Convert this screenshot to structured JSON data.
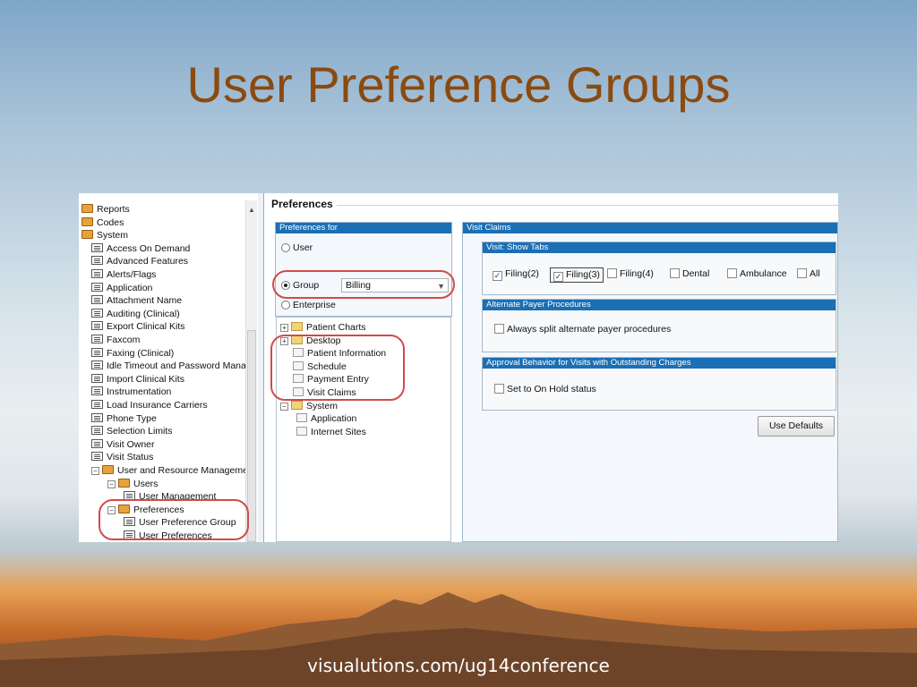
{
  "slide": {
    "title": "User Preference Groups",
    "footer": "visualutions.com/ug14conference"
  },
  "nav_tree": {
    "items": [
      {
        "label": "Reports",
        "icon": "folder-icon",
        "level": 0
      },
      {
        "label": "Codes",
        "icon": "folder-icon",
        "level": 0
      },
      {
        "label": "System",
        "icon": "folder-icon",
        "level": 0
      },
      {
        "label": "Access On Demand",
        "icon": "document-icon",
        "level": 1
      },
      {
        "label": "Advanced Features",
        "icon": "document-icon",
        "level": 1
      },
      {
        "label": "Alerts/Flags",
        "icon": "document-icon",
        "level": 1
      },
      {
        "label": "Application",
        "icon": "document-icon",
        "level": 1
      },
      {
        "label": "Attachment Name",
        "icon": "document-icon",
        "level": 1
      },
      {
        "label": "Auditing (Clinical)",
        "icon": "document-icon",
        "level": 1
      },
      {
        "label": "Export Clinical Kits",
        "icon": "document-icon",
        "level": 1
      },
      {
        "label": "Faxcom",
        "icon": "document-icon",
        "level": 1
      },
      {
        "label": "Faxing (Clinical)",
        "icon": "document-icon",
        "level": 1
      },
      {
        "label": "Idle Timeout and Password Manag",
        "icon": "document-icon",
        "level": 1
      },
      {
        "label": "Import Clinical Kits",
        "icon": "document-icon",
        "level": 1
      },
      {
        "label": "Instrumentation",
        "icon": "document-icon",
        "level": 1
      },
      {
        "label": "Load Insurance Carriers",
        "icon": "document-icon",
        "level": 1
      },
      {
        "label": "Phone Type",
        "icon": "document-icon",
        "level": 1
      },
      {
        "label": "Selection Limits",
        "icon": "document-icon",
        "level": 1
      },
      {
        "label": "Visit Owner",
        "icon": "document-icon",
        "level": 1
      },
      {
        "label": "Visit Status",
        "icon": "document-icon",
        "level": 1
      },
      {
        "label": "User and Resource Management",
        "icon": "folder-icon",
        "level": 1
      },
      {
        "label": "Users",
        "icon": "folder-icon",
        "level": 2
      },
      {
        "label": "User Management",
        "icon": "document-icon",
        "level": 3
      },
      {
        "label": "Preferences",
        "icon": "folder-icon",
        "level": 2
      },
      {
        "label": "User Preference Group",
        "icon": "document-icon",
        "level": 3
      },
      {
        "label": "User Preferences",
        "icon": "document-icon",
        "level": 3
      }
    ]
  },
  "preferences": {
    "title": "Preferences",
    "for_panel": {
      "header": "Preferences for",
      "user_label": "User",
      "group_label": "Group",
      "group_value": "Billing",
      "enterprise_label": "Enterprise",
      "selected": "Group"
    },
    "pref_tree": {
      "items": [
        {
          "label": "Patient Charts",
          "type": "folder",
          "toggle": "+"
        },
        {
          "label": "Desktop",
          "type": "folder",
          "toggle": "+"
        },
        {
          "label": "Patient Information",
          "type": "node"
        },
        {
          "label": "Schedule",
          "type": "node"
        },
        {
          "label": "Payment Entry",
          "type": "node"
        },
        {
          "label": "Visit Claims",
          "type": "node"
        },
        {
          "label": "System",
          "type": "folder",
          "toggle": "-"
        },
        {
          "label": "Application",
          "type": "node"
        },
        {
          "label": "Internet Sites",
          "type": "node"
        }
      ]
    },
    "visit_claims": {
      "header": "Visit Claims",
      "show_tabs": {
        "header": "Visit: Show Tabs",
        "options": [
          {
            "label": "Filing(2)",
            "checked": true
          },
          {
            "label": "Filing(3)",
            "checked": true
          },
          {
            "label": "Filing(4)",
            "checked": false
          },
          {
            "label": "Dental",
            "checked": false
          },
          {
            "label": "Ambulance",
            "checked": false
          },
          {
            "label": "All",
            "checked": false
          }
        ]
      },
      "alternate_payer": {
        "header": "Alternate Payer Procedures",
        "option": "Always split alternate payer procedures"
      },
      "approval": {
        "header": "Approval Behavior for Visits with Outstanding Charges",
        "option": "Set to On Hold status"
      },
      "use_defaults_label": "Use Defaults"
    }
  },
  "colors": {
    "title": "#8a4a10",
    "panel_header": "#1a6fb5",
    "highlight_oval": "#d24a4a"
  }
}
